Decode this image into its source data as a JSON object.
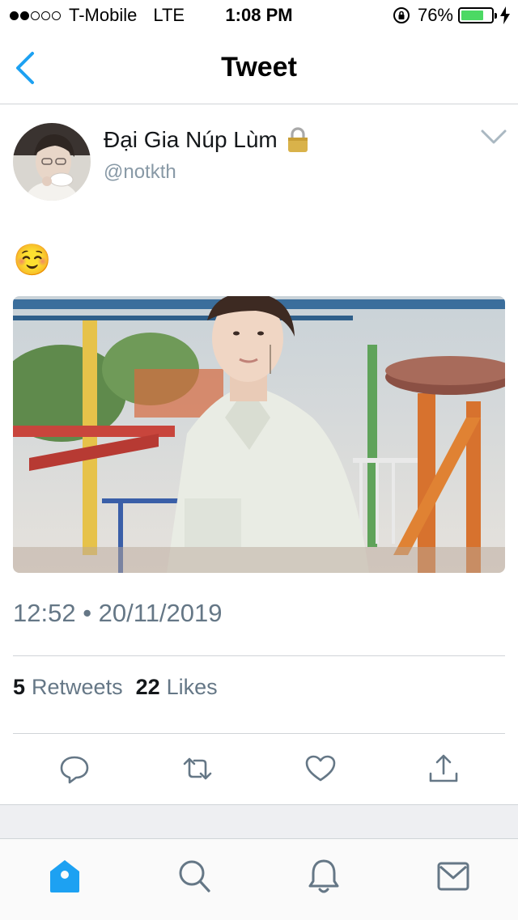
{
  "status_bar": {
    "carrier": "T-Mobile",
    "network": "LTE",
    "time": "1:08 PM",
    "battery_percent": "76%",
    "signal_strength": 2,
    "battery_level": 0.76,
    "battery_color": "#4cd964"
  },
  "nav": {
    "title": "Tweet",
    "back_icon": "chevron-left-icon",
    "accent_color": "#1da1f2"
  },
  "tweet": {
    "author_name": "Đại Gia Núp Lùm",
    "protected_icon": "lock-icon",
    "handle": "@notkth",
    "text": "☺️",
    "timestamp": "12:52 • 20/11/2019",
    "retweets_count": "5",
    "retweets_label": "Retweets",
    "likes_count": "22",
    "likes_label": "Likes"
  },
  "actions": [
    {
      "name": "reply",
      "icon": "reply-icon"
    },
    {
      "name": "retweet",
      "icon": "retweet-icon"
    },
    {
      "name": "like",
      "icon": "heart-icon"
    },
    {
      "name": "share",
      "icon": "share-icon"
    }
  ],
  "tabs": [
    {
      "name": "home",
      "icon": "home-icon",
      "active": true
    },
    {
      "name": "search",
      "icon": "search-icon",
      "active": false
    },
    {
      "name": "notifications",
      "icon": "bell-icon",
      "active": false
    },
    {
      "name": "messages",
      "icon": "mail-icon",
      "active": false
    }
  ]
}
